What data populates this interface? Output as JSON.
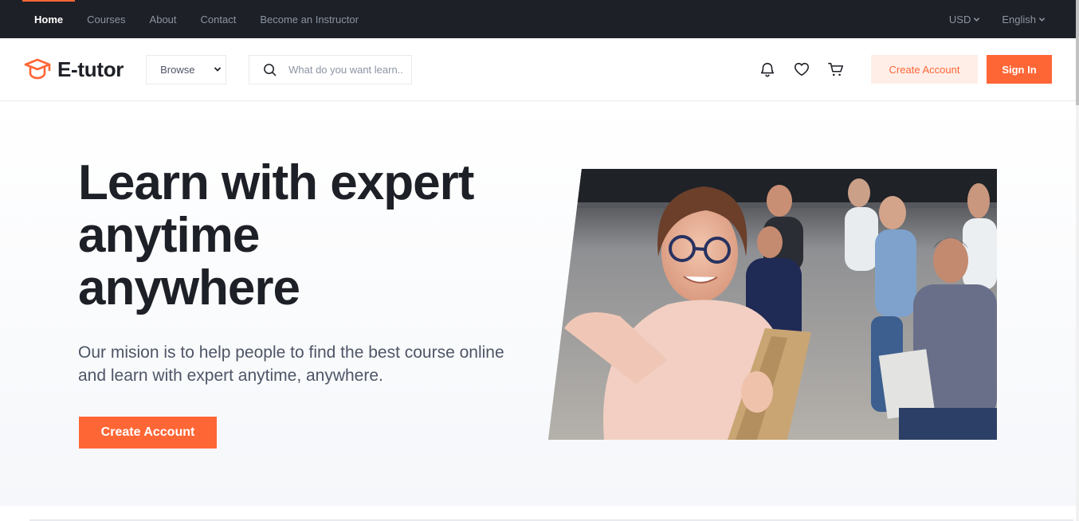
{
  "topbar": {
    "nav": [
      "Home",
      "Courses",
      "About",
      "Contact",
      "Become an Instructor"
    ],
    "active": "Home",
    "currency": "USD",
    "language": "English"
  },
  "header": {
    "logo_text": "E-tutor",
    "browse_label": "Browse",
    "search_placeholder": "What do you want learn...",
    "create_account_label": "Create Account",
    "sign_in_label": "Sign In",
    "icons": [
      "bell-icon",
      "heart-icon",
      "cart-icon",
      "search-icon",
      "graduation-cap-icon",
      "chevron-down-icon"
    ]
  },
  "hero": {
    "title_line1": "Learn with expert",
    "title_line2": "anytime",
    "title_line3": "anywhere",
    "subtitle": "Our mision is to help people to find the best course online and learn with expert anytime, anywhere.",
    "cta_label": "Create Account"
  },
  "colors": {
    "accent": "#ff6636",
    "accent_soft": "#ffeee8",
    "dark": "#1d2026",
    "muted": "#8c94a3",
    "body_text": "#4e5566"
  }
}
